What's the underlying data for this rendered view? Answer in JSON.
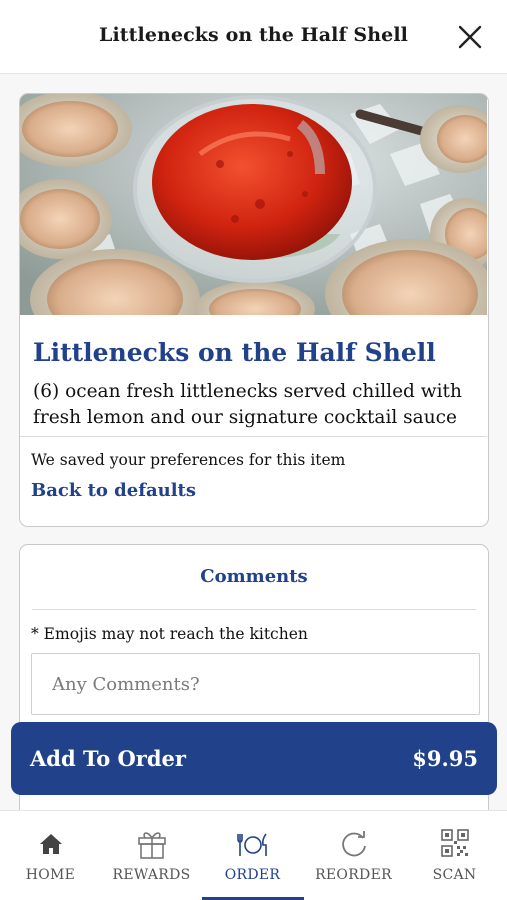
{
  "header": {
    "title": "Littlenecks on the Half Shell",
    "close_icon": "close-icon"
  },
  "item": {
    "title": "Littlenecks on the Half Shell",
    "description": "(6) ocean fresh littlenecks served chilled with fresh lemon and our signature cocktail sauce",
    "preferences_note": "We saved your preferences for this item",
    "defaults_link": "Back to defaults"
  },
  "comments": {
    "title": "Comments",
    "note": "* Emojis may not reach the kitchen",
    "placeholder": "Any Comments?",
    "value": ""
  },
  "order_button": {
    "label": "Add To Order",
    "price": "$9.95"
  },
  "tabs": [
    {
      "label": "HOME",
      "icon": "home-icon",
      "active": false
    },
    {
      "label": "REWARDS",
      "icon": "gift-icon",
      "active": false
    },
    {
      "label": "ORDER",
      "icon": "utensils-icon",
      "active": true
    },
    {
      "label": "REORDER",
      "icon": "reorder-icon",
      "active": false
    },
    {
      "label": "SCAN",
      "icon": "qr-code-icon",
      "active": false
    }
  ],
  "colors": {
    "brand": "#21418b",
    "inactive_tab": "#555555",
    "background": "#f7f7f7"
  }
}
